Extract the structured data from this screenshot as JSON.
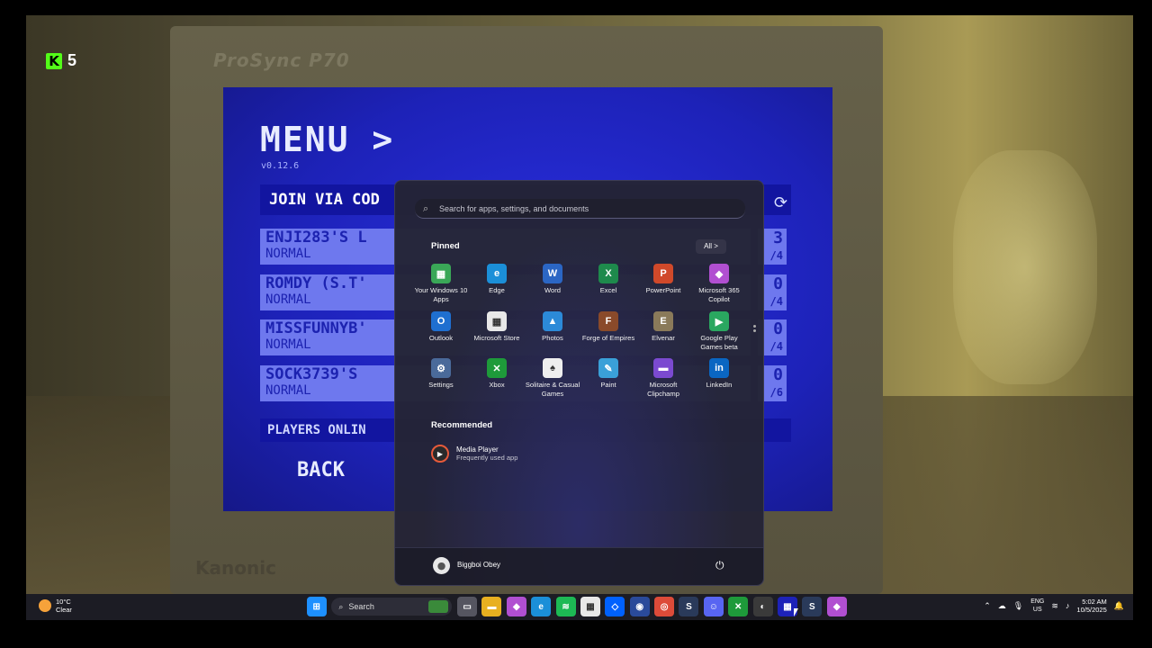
{
  "overlay": {
    "counter": "5",
    "icon": "kick-logo"
  },
  "monitor": {
    "brand_top": "ProSync P70",
    "brand_bottom": "Kanonic"
  },
  "game": {
    "title": "MENU >",
    "version": "v0.12.6",
    "join_label": "JOIN VIA COD",
    "lobbies": [
      {
        "name": "ENJI283'S L",
        "mode": "NORMAL",
        "count": "3",
        "max": "/4"
      },
      {
        "name": "ROMDY (S.T'",
        "mode": "NORMAL",
        "count": "0",
        "max": "/4"
      },
      {
        "name": "MISSFUNNYB'",
        "mode": "NORMAL",
        "count": "0",
        "max": "/4"
      },
      {
        "name": "SOCK3739'S",
        "mode": "NORMAL",
        "count": "0",
        "max": "/6"
      }
    ],
    "players_online": "PLAYERS ONLIN",
    "back_label": "BACK"
  },
  "start_menu": {
    "search_placeholder": "Search for apps, settings, and documents",
    "pinned_title": "Pinned",
    "all_button": "All  >",
    "pinned": [
      {
        "label": "Your Windows 10 Apps",
        "icon": "windows-apps-icon",
        "color": "#3aa757",
        "glyph": "▦"
      },
      {
        "label": "Edge",
        "icon": "edge-icon",
        "color": "#1b8fd8",
        "glyph": "e"
      },
      {
        "label": "Word",
        "icon": "word-icon",
        "color": "#2b66c4",
        "glyph": "W"
      },
      {
        "label": "Excel",
        "icon": "excel-icon",
        "color": "#1e8a4c",
        "glyph": "X"
      },
      {
        "label": "PowerPoint",
        "icon": "powerpoint-icon",
        "color": "#d0492a",
        "glyph": "P"
      },
      {
        "label": "Microsoft 365 Copilot",
        "icon": "copilot-icon",
        "color": "#b14fd1",
        "glyph": "◆"
      },
      {
        "label": "Outlook",
        "icon": "outlook-icon",
        "color": "#1f6fd0",
        "glyph": "O"
      },
      {
        "label": "Microsoft Store",
        "icon": "store-icon",
        "color": "#e8e8e8",
        "glyph": "▦"
      },
      {
        "label": "Photos",
        "icon": "photos-icon",
        "color": "#2c8ad8",
        "glyph": "▲"
      },
      {
        "label": "Forge of Empires",
        "icon": "forge-of-empires-icon",
        "color": "#8a4a2a",
        "glyph": "F"
      },
      {
        "label": "Elvenar",
        "icon": "elvenar-icon",
        "color": "#8a7a5a",
        "glyph": "E"
      },
      {
        "label": "Google Play Games beta",
        "icon": "play-games-icon",
        "color": "#2aa760",
        "glyph": "▶"
      },
      {
        "label": "Settings",
        "icon": "settings-icon",
        "color": "#4a6a9a",
        "glyph": "⚙"
      },
      {
        "label": "Xbox",
        "icon": "xbox-icon",
        "color": "#1e9a3a",
        "glyph": "✕"
      },
      {
        "label": "Solitaire & Casual Games",
        "icon": "solitaire-icon",
        "color": "#eeeeee",
        "glyph": "♠"
      },
      {
        "label": "Paint",
        "icon": "paint-icon",
        "color": "#3aa0d8",
        "glyph": "✎"
      },
      {
        "label": "Microsoft Clipchamp",
        "icon": "clipchamp-icon",
        "color": "#7b4ad0",
        "glyph": "▬"
      },
      {
        "label": "LinkedIn",
        "icon": "linkedin-icon",
        "color": "#0a66c2",
        "glyph": "in"
      }
    ],
    "recommended_title": "Recommended",
    "recommended": [
      {
        "title": "Media Player",
        "subtitle": "Frequently used app",
        "icon": "media-player-icon"
      }
    ],
    "user_name": "Biggboi Obey"
  },
  "taskbar": {
    "weather_temp": "10°C",
    "weather_desc": "Clear",
    "search_label": "Search",
    "apps": [
      {
        "icon": "start-icon",
        "color": "#1e90ff",
        "glyph": "⊞"
      },
      {
        "icon": "task-view-icon",
        "color": "#555560",
        "glyph": "▭"
      },
      {
        "icon": "file-explorer-icon",
        "color": "#e8b020",
        "glyph": "▬"
      },
      {
        "icon": "copilot-icon",
        "color": "#b14fd1",
        "glyph": "◆"
      },
      {
        "icon": "edge-icon",
        "color": "#1b8fd8",
        "glyph": "e"
      },
      {
        "icon": "spotify-icon",
        "color": "#1db954",
        "glyph": "≋"
      },
      {
        "icon": "store-icon",
        "color": "#e8e8e8",
        "glyph": "▦"
      },
      {
        "icon": "dropbox-icon",
        "color": "#0061fe",
        "glyph": "◇"
      },
      {
        "icon": "app-blue-icon",
        "color": "#2a4a9a",
        "glyph": "◉"
      },
      {
        "icon": "chrome-icon",
        "color": "#dd4b39",
        "glyph": "◎"
      },
      {
        "icon": "steam-icon",
        "color": "#2a3a5a",
        "glyph": "S"
      },
      {
        "icon": "discord-icon",
        "color": "#5865f2",
        "glyph": "☺"
      },
      {
        "icon": "xbox-icon",
        "color": "#1e9a3a",
        "glyph": "✕"
      },
      {
        "icon": "obs-icon",
        "color": "#3a3a3a",
        "glyph": "◐"
      },
      {
        "icon": "game-icon",
        "color": "#1d22b8",
        "glyph": "▦"
      },
      {
        "icon": "steam-icon",
        "color": "#2a3a5a",
        "glyph": "S"
      },
      {
        "icon": "copilot-365-icon",
        "color": "#b14fd1",
        "glyph": "◆"
      }
    ],
    "lang_top": "ENG",
    "lang_bottom": "US",
    "time": "5:02 AM",
    "date": "10/5/2025"
  }
}
